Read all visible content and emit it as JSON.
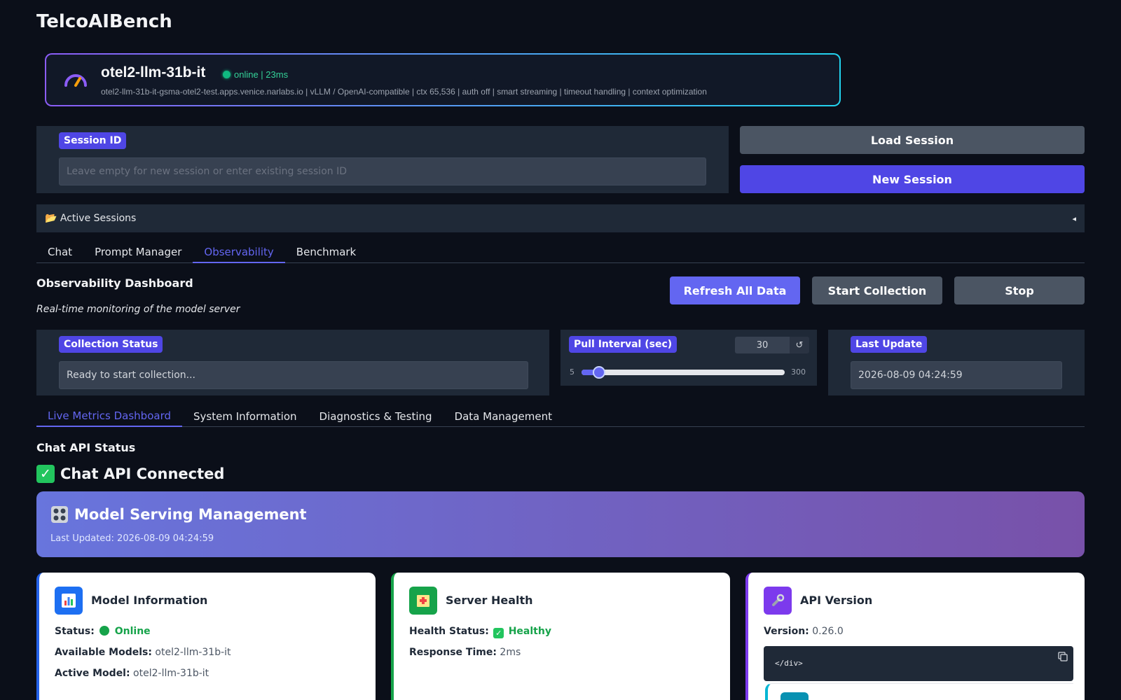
{
  "app": {
    "title": "TelcoAIBench"
  },
  "model_card": {
    "name": "otel2-llm-31b-it",
    "status": "online | 23ms",
    "meta": "otel2-llm-31b-it-gsma-otel2-test.apps.venice.narlabs.io  |  vLLM / OpenAI-compatible  |  ctx 65,536  |  auth off  |  smart streaming | timeout handling | context optimization"
  },
  "session": {
    "label": "Session ID",
    "placeholder": "Leave empty for new session or enter existing session ID",
    "load_label": "Load Session",
    "new_label": "New Session"
  },
  "active_sessions": {
    "label": "📂 Active Sessions",
    "toggle": "◂"
  },
  "main_tabs": [
    {
      "label": "Chat"
    },
    {
      "label": "Prompt Manager"
    },
    {
      "label": "Observability",
      "active": true
    },
    {
      "label": "Benchmark"
    }
  ],
  "observability": {
    "title": "Observability Dashboard",
    "subtitle": "Real-time monitoring of the model server",
    "refresh_label": "Refresh All Data",
    "start_label": "Start Collection",
    "stop_label": "Stop"
  },
  "collection": {
    "label": "Collection Status",
    "value": "Ready to start collection..."
  },
  "pull_interval": {
    "label": "Pull Interval (sec)",
    "value": "30",
    "min": "5",
    "max": "300",
    "reset": "↺"
  },
  "last_update": {
    "label": "Last Update",
    "value": "2026-08-09 04:24:59"
  },
  "sub_tabs": [
    {
      "label": "Live Metrics Dashboard",
      "active": true
    },
    {
      "label": "System Information"
    },
    {
      "label": "Diagnostics & Testing"
    },
    {
      "label": "Data Management"
    }
  ],
  "chat_api": {
    "section_title": "Chat API Status",
    "connected": "Chat API Connected"
  },
  "banner": {
    "title": "Model Serving Management",
    "updated": "Last Updated: 2026-08-09 04:24:59"
  },
  "cards": {
    "model_info": {
      "title": "Model Information",
      "status_label": "Status:",
      "status_value": "Online",
      "available_label": "Available Models:",
      "available_value": "otel2-llm-31b-it",
      "active_label": "Active Model:",
      "active_value": "otel2-llm-31b-it"
    },
    "server_health": {
      "title": "Server Health",
      "health_label": "Health Status:",
      "health_value": "Healthy",
      "response_label": "Response Time:",
      "response_value": "2ms"
    },
    "api_version": {
      "title": "API Version",
      "version_label": "Version:",
      "version_value": "0.26.0",
      "code": "</div>"
    }
  },
  "colors": {
    "accent": "#4f46e5",
    "accent_light": "#6366f1",
    "online": "#10b981",
    "healthy": "#16a34a"
  }
}
